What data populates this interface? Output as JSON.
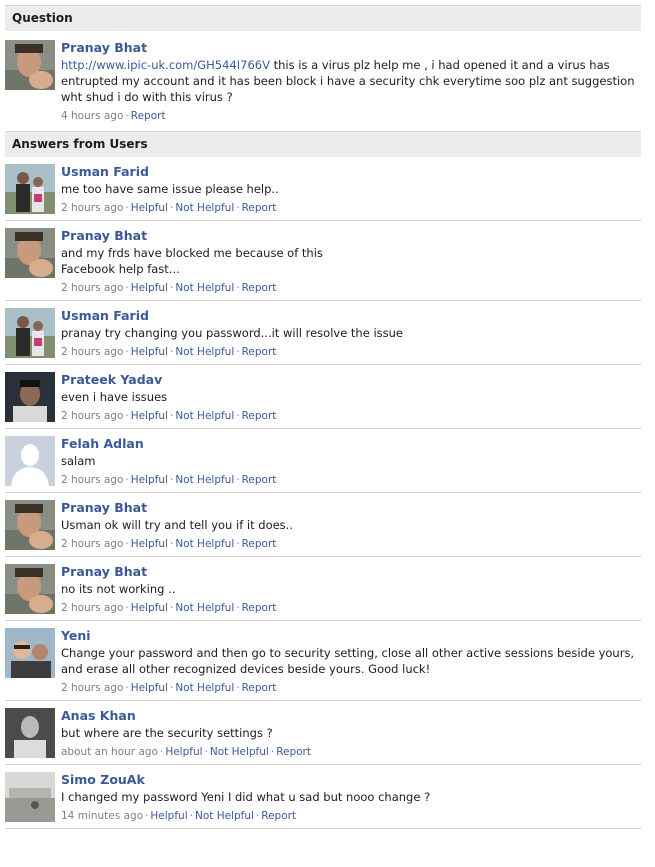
{
  "question_header": "Question",
  "answers_header": "Answers from Users",
  "question": {
    "author": "Pranay Bhat",
    "link": "http://www.ipic-uk.com/GH544I766V",
    "text": " this is a virus plz help me , i had opened it and a virus has entrupted my account and it has been block i have a security chk everytime soo plz ant suggestion wht shud i do with this virus ?",
    "time": "4 hours ago",
    "report": "Report",
    "avatar_icon": "user-photo-icon"
  },
  "labels": {
    "helpful": "Helpful",
    "not_helpful": "Not Helpful",
    "report": "Report",
    "separator": "·"
  },
  "answers": [
    {
      "author": "Usman Farid",
      "text": "me too have same issue please help..",
      "time": "2 hours ago",
      "avatar": "couple"
    },
    {
      "author": "Pranay Bhat",
      "text": "and my frds have blocked me because of this\nFacebook help fast...",
      "time": "2 hours ago",
      "avatar": "pranay"
    },
    {
      "author": "Usman Farid",
      "text": "pranay try changing you password...it will resolve the issue",
      "time": "2 hours ago",
      "avatar": "couple"
    },
    {
      "author": "Prateek Yadav",
      "text": "even i have issues",
      "time": "2 hours ago",
      "avatar": "dark"
    },
    {
      "author": "Felah Adlan",
      "text": "salam",
      "time": "2 hours ago",
      "avatar": "default"
    },
    {
      "author": "Pranay Bhat",
      "text": "Usman ok will try and tell you if it does..",
      "time": "2 hours ago",
      "avatar": "pranay"
    },
    {
      "author": "Pranay Bhat",
      "text": "no its not working ..",
      "time": "2 hours ago",
      "avatar": "pranay"
    },
    {
      "author": "Yeni",
      "text": "Change your password and then go to security setting, close all other active sessions beside yours, and erase all other recognized devices beside yours. Good luck!",
      "time": "2 hours ago",
      "avatar": "yeni"
    },
    {
      "author": "Anas Khan",
      "text": "but where are the security settings ?",
      "time": "about an hour ago",
      "avatar": "anas"
    },
    {
      "author": "Simo ZouAk",
      "text": "I changed my password Yeni I did what u sad but nooo change ?",
      "time": "14 minutes ago",
      "avatar": "simo"
    }
  ],
  "colors": {
    "link": "#3b5998",
    "header_bg": "#ececec",
    "meta": "#808080"
  }
}
